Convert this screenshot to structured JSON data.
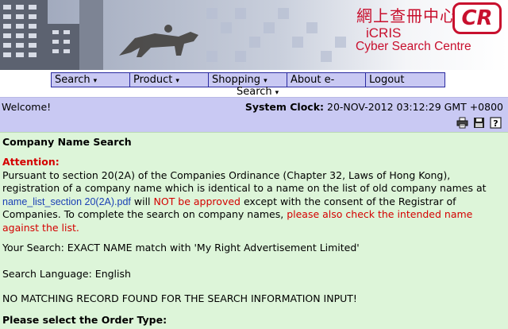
{
  "banner": {
    "chinese_name": "網上查冊中心",
    "cr_logo": "CR",
    "icris": "iCRIS",
    "subtitle": "Cyber Search Centre"
  },
  "nav": {
    "items": [
      {
        "label": "Search",
        "arrow": "▾"
      },
      {
        "label": "Product",
        "arrow": "▾"
      },
      {
        "label": "Shopping",
        "arrow": "▾"
      },
      {
        "label": "About e-",
        "label_line2": "Search",
        "arrow": "▾"
      },
      {
        "label": "Logout"
      }
    ]
  },
  "status": {
    "welcome": "Welcome!",
    "clock_label": "System Clock:",
    "clock_value": "20-NOV-2012 03:12:29 GMT +0800"
  },
  "toolbar": {
    "icons": [
      "print-icon",
      "save-icon",
      "help-icon"
    ],
    "help_glyph": "?"
  },
  "content": {
    "title": "Company Name Search",
    "attention_label": "Attention:",
    "notice_part1": "Pursuant to section 20(2A) of the Companies Ordinance (Chapter 32, Laws of Hong Kong), registration of a company name which is identical to a name on the list of old company names at ",
    "notice_link": "name_list_section 20(2A).pdf",
    "notice_part2": " will ",
    "notice_not_approved": "NOT be approved",
    "notice_part3": " except with the consent of the Registrar of Companies. To complete the search on company names, ",
    "notice_check": "please also check the intended name against the list.",
    "your_search": "Your Search: EXACT NAME match with 'My Right Advertisement Limited'",
    "search_language": "Search Language: English",
    "no_match": "NO MATCHING RECORD FOUND FOR THE SEARCH INFORMATION INPUT!",
    "order_type": "Please select the Order Type:"
  },
  "colors": {
    "nav_bg": "#c9c9f3",
    "nav_border": "#2a2aa0",
    "content_bg": "#ddf5d9",
    "alert_red": "#d40000",
    "link_blue": "#1a3fb5",
    "brand_red": "#c8102e"
  }
}
